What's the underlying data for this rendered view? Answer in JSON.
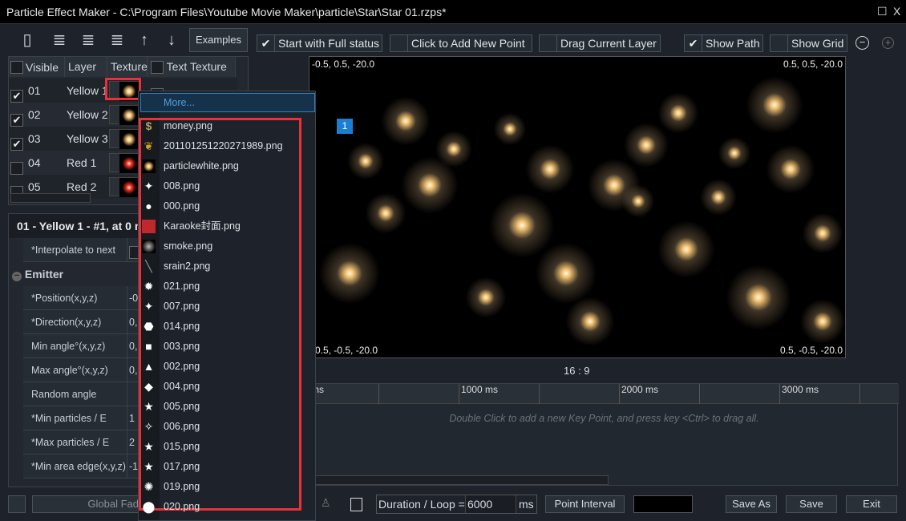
{
  "window": {
    "title": "Particle Effect Maker - C:\\Program Files\\Youtube Movie Maker\\particle\\Star\\Star 01.rzps*",
    "maximize": "☐",
    "close": "X"
  },
  "toolbar": {
    "examples": "Examples",
    "start_full": "Start with Full status",
    "start_full_checked": true,
    "click_add": "Click to Add New Point",
    "click_add_checked": false,
    "drag_layer": "Drag Current Layer",
    "drag_layer_checked": false,
    "show_path": "Show Path",
    "show_path_checked": true,
    "show_grid": "Show Grid",
    "show_grid_checked": false,
    "zoom_out": "−",
    "zoom_in": "+"
  },
  "layers": {
    "headers": [
      "Visible",
      "Layer",
      "Texture",
      "Text Texture"
    ],
    "rows": [
      {
        "visible": true,
        "id": "01",
        "name": "Yellow 1",
        "color": "#f5c070"
      },
      {
        "visible": true,
        "id": "02",
        "name": "Yellow 2",
        "color": "#f5c070"
      },
      {
        "visible": true,
        "id": "03",
        "name": "Yellow 3",
        "color": "#f5c070"
      },
      {
        "visible": false,
        "id": "04",
        "name": "Red 1",
        "color": "#ff3020"
      },
      {
        "visible": false,
        "id": "05",
        "name": "Red 2",
        "color": "#ff3020"
      }
    ]
  },
  "props": {
    "title": "01 - Yellow 1 - #1, at 0 m",
    "interpolate": "*Interpolate to next",
    "section": "Emitter",
    "rows": [
      {
        "label": "*Position(x,y,z)",
        "value": "-0"
      },
      {
        "label": "*Direction(x,y,z)",
        "value": "0,"
      },
      {
        "label": "Min angle°(x,y,z)",
        "value": "0,"
      },
      {
        "label": "Max angle°(x,y,z)",
        "value": "0,"
      },
      {
        "label": "Random angle",
        "value": ""
      },
      {
        "label": "*Min particles / E",
        "value": "1"
      },
      {
        "label": "*Max particles / E",
        "value": "2"
      },
      {
        "label": "*Min area edge(x,y,z)",
        "value": "-1"
      }
    ]
  },
  "global_fade": "Global Fad",
  "preview": {
    "tl": "-0.5, 0.5, -20.0",
    "tr": "0.5, 0.5, -20.0",
    "bl": "-0.5, -0.5, -20.0",
    "br": "0.5, -0.5, -20.0",
    "point_label": "1",
    "aspect": "16 : 9"
  },
  "timeline": {
    "ticks": [
      "ms",
      "1000 ms",
      "2000 ms",
      "3000 ms"
    ],
    "hint": "Double Click to add a new Key Point, and press key <Ctrl> to drag all."
  },
  "bottom": {
    "duration_label": "Duration / Loop =",
    "duration_value": "6000",
    "unit": "ms",
    "point_interval": "Point Interval",
    "save_as": "Save As",
    "save": "Save",
    "exit": "Exit"
  },
  "dropdown": {
    "more": "More...",
    "items": [
      {
        "name": "money.png",
        "icon": "dollar"
      },
      {
        "name": "201101251220271989.png",
        "icon": "leaf"
      },
      {
        "name": "particlewhite.png",
        "icon": "glow"
      },
      {
        "name": "008.png",
        "icon": "sparkle"
      },
      {
        "name": "000.png",
        "icon": "circle"
      },
      {
        "name": "Karaoke封面.png",
        "icon": "karaoke"
      },
      {
        "name": "smoke.png",
        "icon": "smoke"
      },
      {
        "name": "srain2.png",
        "icon": "streak"
      },
      {
        "name": "021.png",
        "icon": "burst"
      },
      {
        "name": "007.png",
        "icon": "star4"
      },
      {
        "name": "014.png",
        "icon": "octagon"
      },
      {
        "name": "003.png",
        "icon": "square"
      },
      {
        "name": "002.png",
        "icon": "triangle"
      },
      {
        "name": "004.png",
        "icon": "diamond"
      },
      {
        "name": "005.png",
        "icon": "star-thin"
      },
      {
        "name": "006.png",
        "icon": "concave-square"
      },
      {
        "name": "015.png",
        "icon": "star"
      },
      {
        "name": "017.png",
        "icon": "star-bold"
      },
      {
        "name": "019.png",
        "icon": "seal"
      },
      {
        "name": "020.png",
        "icon": "blob"
      }
    ]
  }
}
